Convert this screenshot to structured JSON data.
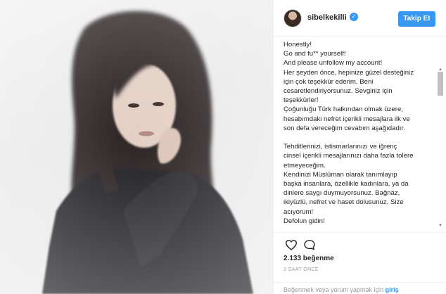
{
  "post": {
    "username": "sibelkekilli",
    "verified_mark": "✓",
    "follow_label": "Takip Et",
    "caption_lines": [
      "Honestly!",
      "Go and fu** yourself!",
      "And please unfollow my account!",
      "Her şeyden önce, hepinize güzel desteğiniz",
      "için çok teşekkür ederim. Beni",
      "cesaretlendiriyorsunuz. Sevginiz için",
      "teşekkürler!",
      "Çoğunluğu Türk halkından olmak üzere,",
      "hesabımdaki nefret içerikli mesajlara ilk ve",
      "son defa vereceğim cevabım aşağıdadır.",
      "",
      "Tehditlerinizi, istismarlarınızı ve iğrenç",
      "cinsel içerikli mesajlarınızı daha fazla tolere",
      "etmeyeceğim.",
      "Kendinizi Müslüman olarak tanımlayıp",
      "başka insanlara, özellikle kadınlara, ya da",
      "dinlere saygı duymuyorsunuz. Bağnaz,",
      "ikiyüzlü, nefret ve haset dolusunuz. Size",
      "acıyorum!",
      "Defolun gidin!"
    ],
    "likes_text": "2.133 beğenme",
    "time_text": "2 SAAT ÖNCE",
    "login_prompt": "Beğenmek veya yorum yapmak için",
    "login_link": "giriş"
  },
  "icons": {
    "like": "heart-outline-icon",
    "comment": "comment-bubble-icon",
    "verified": "verified-badge-icon"
  },
  "colors": {
    "accent": "#3897f0",
    "text": "#262626",
    "muted": "#999999"
  }
}
